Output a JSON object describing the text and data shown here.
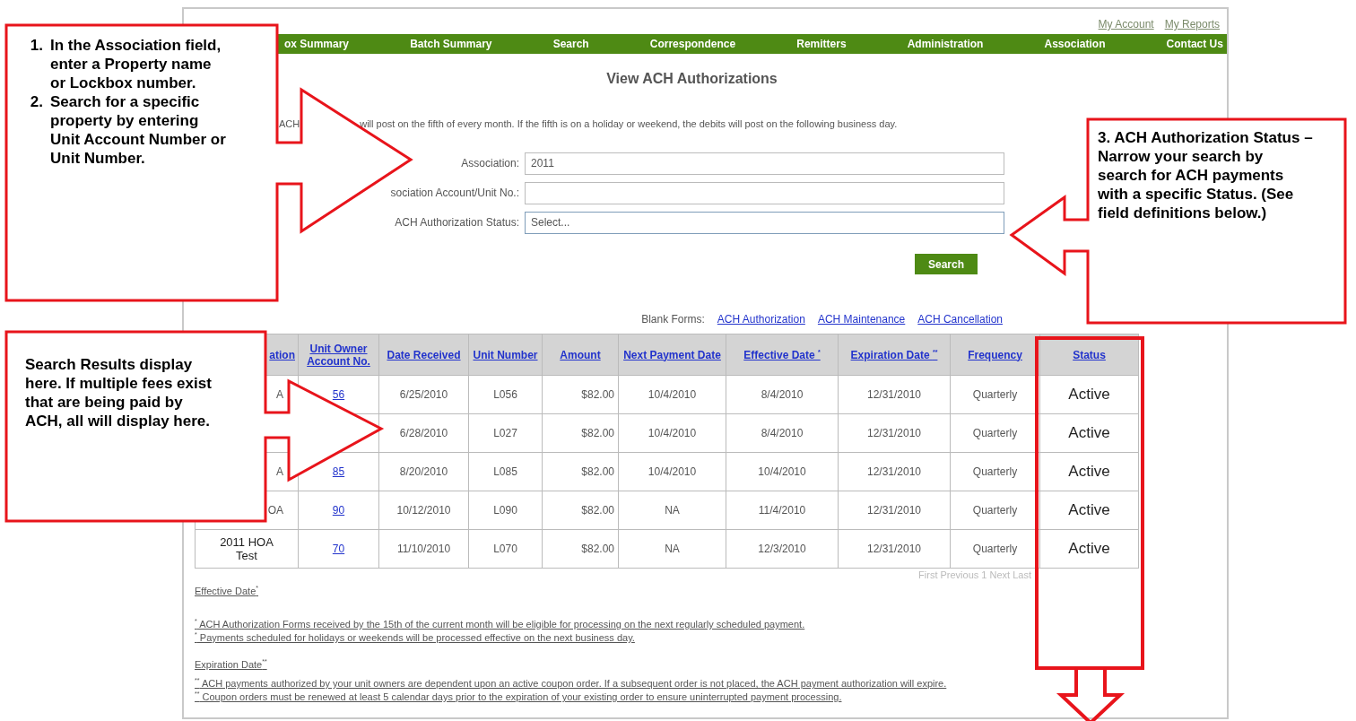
{
  "top_links": [
    "My Account",
    "My Reports"
  ],
  "nav": [
    "ox Summary",
    "Batch Summary",
    "Search",
    "Correspondence",
    "Remitters",
    "Administration",
    "Association",
    "Contact Us"
  ],
  "title": "View ACH Authorizations",
  "notice": [
    "ACH",
    "will post on the fifth of every month. If the fifth is on a holiday or weekend, the debits will post on the following business day."
  ],
  "form": {
    "fields": [
      {
        "label": "Association:",
        "kind": "text",
        "value": "2011"
      },
      {
        "label": "sociation Account/Unit No.:",
        "kind": "text"
      },
      {
        "label": "ACH Authorization Status:",
        "kind": "select",
        "value": "Select..."
      }
    ],
    "button": "Search"
  },
  "blank_forms": {
    "label": "Blank Forms:",
    "links": [
      "ACH Authorization",
      "ACH Maintenance",
      "ACH Cancellation"
    ]
  },
  "table": {
    "columns": [
      "ation",
      "Unit Owner Account No.",
      "Date Received",
      "Unit Number",
      "Amount",
      "Next Payment Date",
      "Effective Date $^{*}$",
      "Expiration Date $^{**}$",
      "Frequency",
      "Status"
    ],
    "rows": [
      {
        "association": "A",
        "account": "56",
        "date_received": "6/25/2010",
        "unit_number": "L056",
        "amount": "$82.00",
        "next_payment": "10/4/2010",
        "effective": "8/4/2010",
        "expiration": "12/31/2010",
        "frequency": "Quarterly",
        "status": "Active"
      },
      {
        "date_received": "6/28/2010",
        "unit_number": "L027",
        "amount": "$82.00",
        "next_payment": "10/4/2010",
        "effective": "8/4/2010",
        "expiration": "12/31/2010",
        "frequency": "Quarterly",
        "status": "Active"
      },
      {
        "association": "A",
        "account": "85",
        "date_received": "8/20/2010",
        "unit_number": "L085",
        "amount": "$82.00",
        "next_payment": "10/4/2010",
        "effective": "10/4/2010",
        "expiration": "12/31/2010",
        "frequency": "Quarterly",
        "status": "Active"
      },
      {
        "association": "OA",
        "account": "90",
        "date_received": "10/12/2010",
        "unit_number": "L090",
        "amount": "$82.00",
        "next_payment": "NA",
        "effective": "11/4/2010",
        "expiration": "12/31/2010",
        "frequency": "Quarterly",
        "status": "Active"
      },
      {
        "association": "2011 HOA Test",
        "account": "70",
        "date_received": "11/10/2010",
        "unit_number": "L070",
        "amount": "$82.00",
        "next_payment": "NA",
        "effective": "12/3/2010",
        "expiration": "12/31/2010",
        "frequency": "Quarterly",
        "status": "Active"
      }
    ]
  },
  "pager": "First Previous 1 Next Last",
  "footnotes": [
    {
      "heading": "Effective Date$^{*}$",
      "lines": [
        "$^{*}$ ACH Authorization Forms received by the 15th of the current month will be eligible for processing on the next regularly scheduled payment.",
        "$^{*}$ Payments scheduled for holidays or weekends will be processed effective on the next business day."
      ]
    },
    {
      "heading": "Expiration Date$^{**}$",
      "lines": [
        "$^{**}$ ACH payments authorized by your unit owners are dependent upon an active coupon order. If a subsequent order is not placed, the ACH payment authorization will expire.",
        "$^{**}$ Coupon orders must be renewed at least 5 calendar days prior to the expiration of your existing order to ensure uninterrupted payment processing."
      ]
    }
  ],
  "callouts": [
    {
      "kind": "pointer-right",
      "items": [
        {
          "number": "1.",
          "text": "In the Association field, enter a Property name or Lockbox number."
        },
        {
          "number": "2.",
          "text": "Search for a specific property by entering Unit Account Number or Unit Number."
        }
      ]
    },
    {
      "kind": "pointer-left",
      "text": "3. ACH Authorization Status – Narrow your search by search for ACH payments with a specific Status. (See field definitions below.)"
    },
    {
      "kind": "pointer-right",
      "text": "Search Results display here.  If multiple fees exist that are being paid by ACH, all will display here."
    },
    {
      "kind": "frame-down"
    }
  ]
}
